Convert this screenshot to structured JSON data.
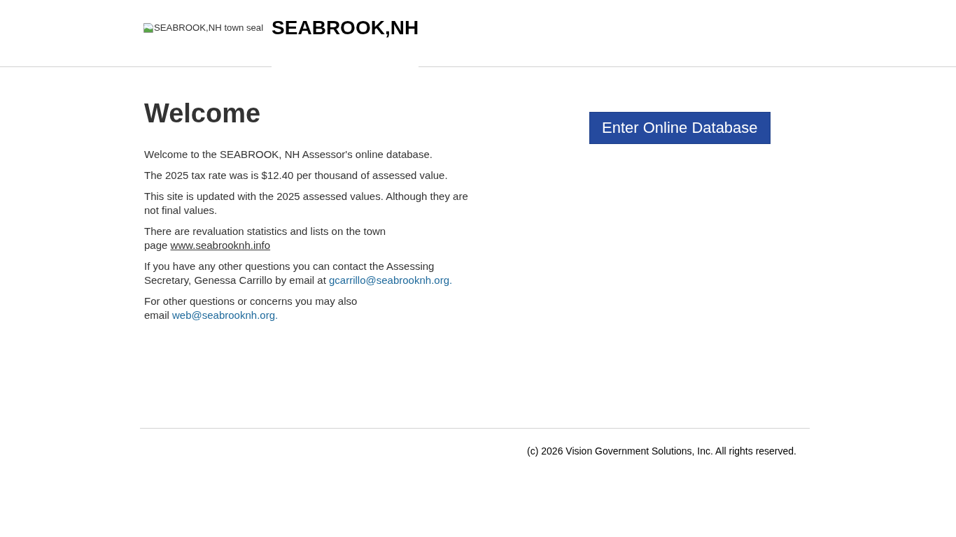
{
  "header": {
    "seal_image": {
      "alt": "SEABROOK,NH town seal"
    },
    "title": "SEABROOK,NH"
  },
  "welcome": {
    "heading": "Welcome",
    "paragraphs": [
      {
        "parts": [
          {
            "kind": "text",
            "text": "Welcome to the SEABROOK, NH Assessor's online database."
          }
        ]
      },
      {
        "parts": [
          {
            "kind": "text",
            "text": "The 2025 tax rate was is $12.40 per thousand of assessed value."
          }
        ]
      },
      {
        "parts": [
          {
            "kind": "text",
            "text": "This site is updated with the 2025 assessed values. Although they are not final values."
          }
        ]
      },
      {
        "parts": [
          {
            "kind": "text",
            "text": "There are revaluation statistics and lists on the town page "
          },
          {
            "kind": "web_link",
            "text": "www.seabrooknh.info"
          }
        ]
      },
      {
        "parts": [
          {
            "kind": "text",
            "text": "If you have any other questions you can contact the Assessing Secretary, Genessa Carrillo by email at "
          },
          {
            "kind": "email_link",
            "text": "gcarrillo@seabrooknh.org."
          }
        ]
      },
      {
        "parts": [
          {
            "kind": "text",
            "text": "For other questions or concerns you may also email "
          },
          {
            "kind": "email_link",
            "text": "web@seabrooknh.org."
          }
        ]
      }
    ]
  },
  "enter_button": {
    "label": "Enter Online Database"
  },
  "footer": {
    "copyright": "(c) 2026 Vision Government Solutions, Inc. All rights reserved."
  }
}
